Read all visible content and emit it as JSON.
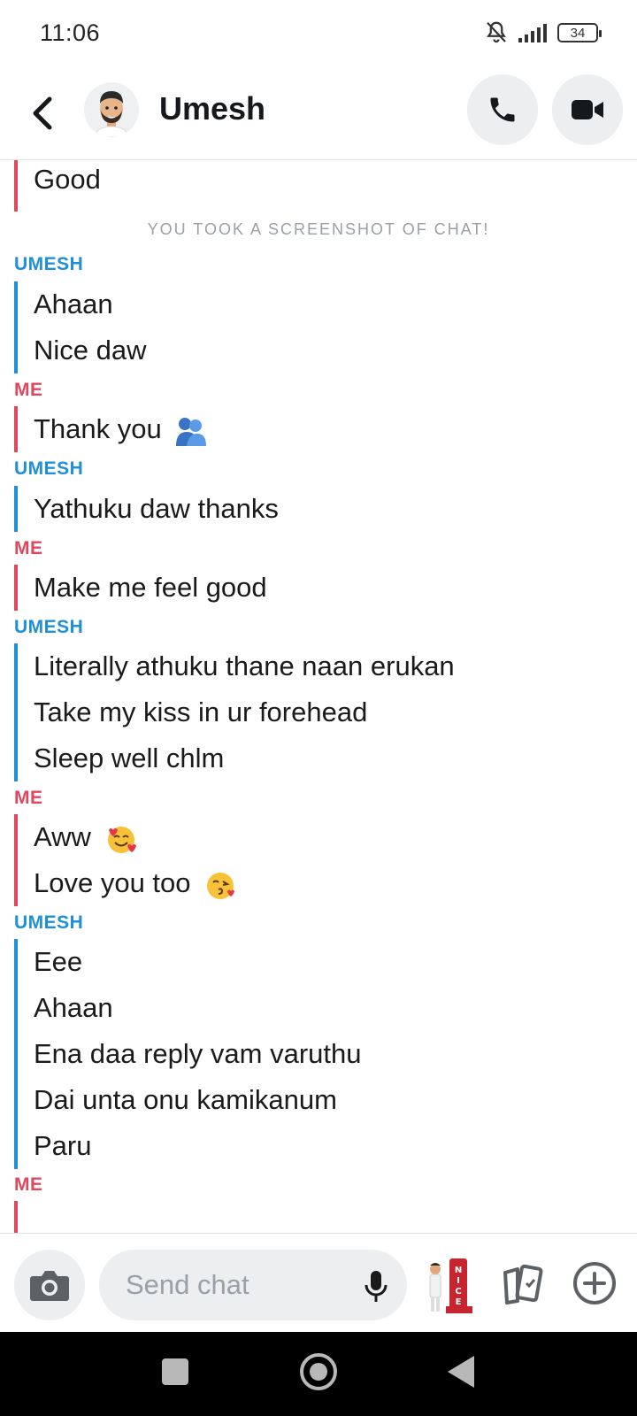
{
  "status_bar": {
    "time": "11:06",
    "battery": "34",
    "icons": [
      "bell-muted-icon",
      "signal-icon",
      "battery-icon"
    ]
  },
  "header": {
    "contact_name": "Umesh",
    "buttons": [
      "back-icon",
      "phone-icon",
      "video-camera-icon"
    ]
  },
  "chat": {
    "system_note": "YOU TOOK A SCREENSHOT OF CHAT!",
    "groups": [
      {
        "sender": "",
        "role": "me",
        "messages": [
          "Good"
        ]
      },
      {
        "sender": "UMESH",
        "role": "umesh",
        "messages": [
          "Ahaan",
          "Nice daw"
        ]
      },
      {
        "sender": "ME",
        "role": "me",
        "messages": [
          "Thank you"
        ]
      },
      {
        "sender": "UMESH",
        "role": "umesh",
        "messages": [
          "Yathuku daw thanks"
        ]
      },
      {
        "sender": "ME",
        "role": "me",
        "messages": [
          "Make me feel good"
        ]
      },
      {
        "sender": "UMESH",
        "role": "umesh",
        "messages": [
          "Literally athuku thane naan erukan",
          "Take my kiss in ur forehead",
          "Sleep well chlm"
        ]
      },
      {
        "sender": "ME",
        "role": "me",
        "messages": [
          "Aww",
          "Love you too"
        ]
      },
      {
        "sender": "UMESH",
        "role": "umesh",
        "messages": [
          "Eee",
          "Ahaan",
          "Ena daa reply vam varuthu",
          "Dai unta onu kamikanum",
          "Paru"
        ]
      },
      {
        "sender": "ME",
        "role": "me",
        "messages": []
      }
    ],
    "emojis": {
      "thank_you": "people-hugging-emoji",
      "aww": "smiling-face-with-hearts-emoji",
      "love_you_too": "face-blowing-kiss-emoji"
    }
  },
  "input_bar": {
    "placeholder": "Send chat",
    "buttons": [
      "camera-icon",
      "microphone-icon",
      "bitmoji-sticker-icon",
      "cards-icon",
      "plus-icon"
    ]
  },
  "colors": {
    "me": "#e0475c",
    "umesh": "#1e8fd9",
    "system_note": "#9aa0a6",
    "button_bg": "#eceef0"
  }
}
